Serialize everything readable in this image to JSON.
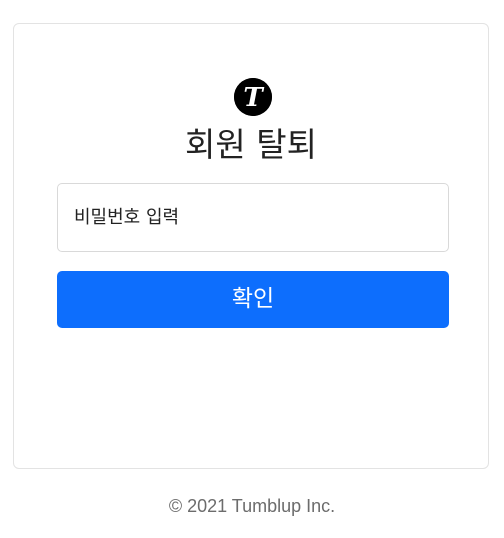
{
  "logo": {
    "icon": "tumblup-t-logo-icon",
    "letter": "T"
  },
  "form": {
    "title": "회원 탈퇴",
    "password_placeholder": "비밀번호 입력",
    "password_value": "",
    "confirm_label": "확인"
  },
  "footer": {
    "copyright": "© 2021 Tumblup Inc."
  },
  "colors": {
    "accent": "#0d6efd",
    "logo_bg": "#000000",
    "footer_text": "#6c6c6c",
    "card_border": "#e3e3e3"
  }
}
